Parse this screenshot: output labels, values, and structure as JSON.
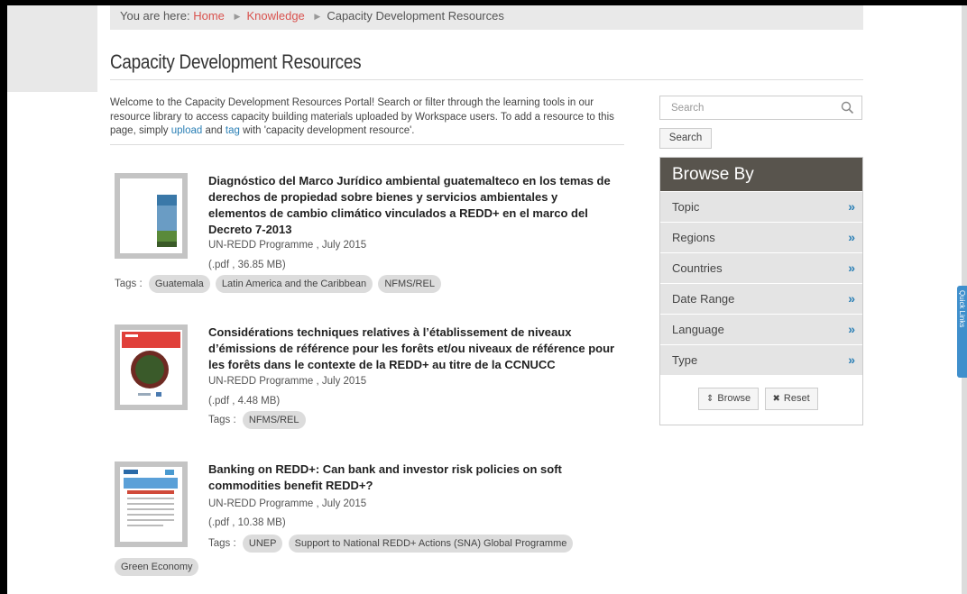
{
  "breadcrumb": {
    "prefix": "You are here:",
    "home": "Home",
    "knowledge": "Knowledge",
    "current": "Capacity Development Resources"
  },
  "page": {
    "title": "Capacity Development Resources",
    "intro_part1": "Welcome to the Capacity Development Resources Portal! Search or filter through the learning tools in our resource library to access capacity building materials uploaded by Workspace users. To add a resource to this page, simply ",
    "intro_upload": "upload",
    "intro_and": " and ",
    "intro_tag": "tag",
    "intro_part2": " with 'capacity development resource'."
  },
  "resources": [
    {
      "title": "Diagnóstico del Marco Jurídico ambiental guatemalteco en los temas de derechos de propiedad sobre bienes y servicios ambientales y elementos de cambio climático vinculados a REDD+ en el marco del Decreto 7-2013",
      "author": "UN-REDD Programme , July 2015",
      "file": "(.pdf , 36.85 MB)",
      "tags_label": "Tags :",
      "tags": [
        "Guatemala",
        "Latin America and the Caribbean",
        "NFMS/REL"
      ]
    },
    {
      "title": "Considérations techniques relatives à l’établissement de niveaux d’émissions de référence pour les forêts et/ou niveaux de référence pour les forêts dans le contexte de la REDD+ au titre de la CCNUCC",
      "author": "UN-REDD Programme , July 2015",
      "file": "(.pdf , 4.48 MB)",
      "tags_label": "Tags :",
      "tags": [
        "NFMS/REL"
      ]
    },
    {
      "title": "Banking on REDD+: Can bank and investor risk policies on soft commodities benefit REDD+?",
      "author": "UN-REDD Programme , July 2015",
      "file": "(.pdf , 10.38 MB)",
      "tags_label": "Tags :",
      "tags": [
        "UNEP",
        "Support to National REDD+ Actions (SNA) Global Programme",
        "Green Economy"
      ]
    }
  ],
  "search": {
    "placeholder": "Search",
    "button": "Search"
  },
  "browse": {
    "heading": "Browse By",
    "items": [
      "Topic",
      "Regions",
      "Countries",
      "Date Range",
      "Language",
      "Type"
    ],
    "chevron": "»",
    "browse_button": "Browse",
    "reset_button": "Reset"
  },
  "side_tab": {
    "label": "Quick Links"
  },
  "colors": {
    "link": "#2a7fb5",
    "breadcrumb_link": "#d9534f",
    "browse_header": "#58544d",
    "side_tab": "#3f8fcc"
  }
}
